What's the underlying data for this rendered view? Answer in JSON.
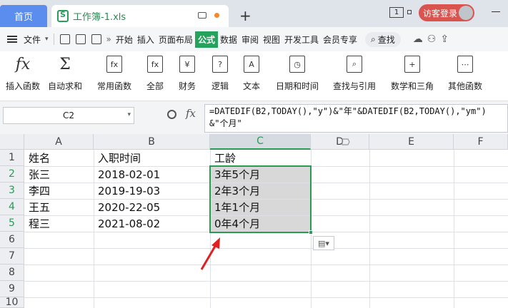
{
  "titlebar": {
    "home_tab": "首页",
    "doc_tab": "工作簿-1.xls",
    "new_tab": "+",
    "window_count": "1",
    "login_label": "访客登录"
  },
  "menu": {
    "file": "文件",
    "items": [
      "开始",
      "插入",
      "页面布局",
      "公式",
      "数据",
      "审阅",
      "视图",
      "开发工具",
      "会员专享"
    ],
    "active": "公式",
    "search": "查找"
  },
  "ribbon": {
    "buttons": [
      {
        "label": "插入函数",
        "icon": "fx-icon"
      },
      {
        "label": "自动求和",
        "icon": "sigma-icon"
      },
      {
        "label": "常用函数",
        "icon": "star-fx-icon"
      },
      {
        "label": "全部",
        "icon": "fx-box-icon"
      },
      {
        "label": "财务",
        "icon": "yen-icon"
      },
      {
        "label": "逻辑",
        "icon": "question-icon"
      },
      {
        "label": "文本",
        "icon": "text-a-icon"
      },
      {
        "label": "日期和时间",
        "icon": "clock-icon"
      },
      {
        "label": "查找与引用",
        "icon": "lookup-icon"
      },
      {
        "label": "数学和三角",
        "icon": "math-icon"
      },
      {
        "label": "其他函数",
        "icon": "more-functions-icon"
      }
    ]
  },
  "formula_bar": {
    "cell_ref": "C2",
    "fx": "fx",
    "formula": "=DATEDIF(B2,TODAY(),\"y\")&\"年\"&DATEDIF(B2,TODAY(),\"ym\")&\"个月\""
  },
  "sheet": {
    "columns": [
      "A",
      "B",
      "C",
      "D",
      "E",
      "F"
    ],
    "rows": [
      "1",
      "2",
      "3",
      "4",
      "5",
      "6",
      "7",
      "8",
      "9",
      "10"
    ],
    "header_row": [
      "姓名",
      "入职时间",
      "工龄"
    ],
    "data": [
      [
        "张三",
        "2018-02-01",
        "3年5个月"
      ],
      [
        "李四",
        "2019-19-03",
        "2年3个月"
      ],
      [
        "王五",
        "2020-22-05",
        "1年1个月"
      ],
      [
        "程三",
        "2021-08-02",
        "0年4个月"
      ]
    ],
    "selected_cell": "C2",
    "selected_range": "C2:C5"
  },
  "colors": {
    "accent_green": "#2a9a55",
    "home_tab_blue": "#5b8def",
    "login_red": "#d9534f",
    "annotation_arrow": "#e02020"
  }
}
